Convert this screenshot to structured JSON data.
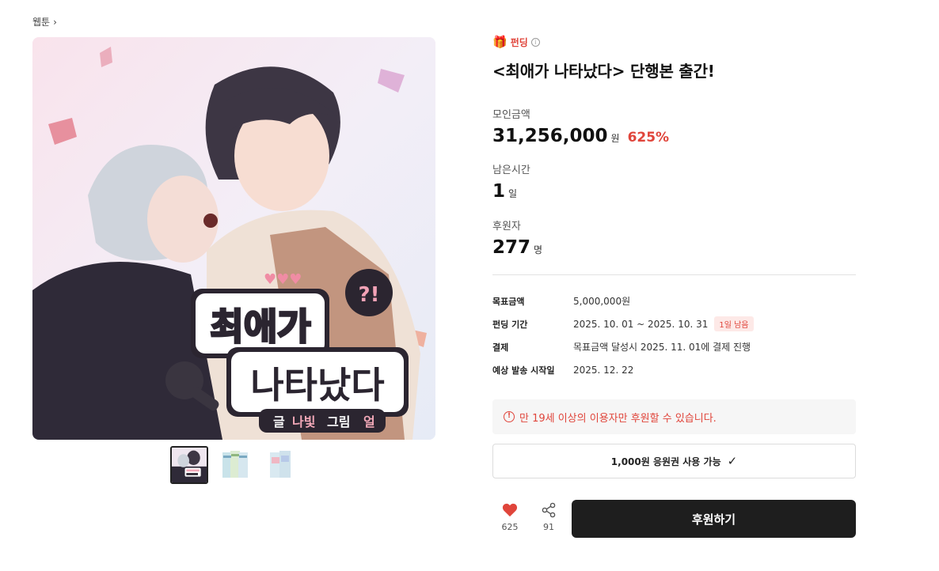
{
  "breadcrumb": {
    "label": "웹툰",
    "chevron": "›"
  },
  "cover": {
    "logo_line1": "최애가",
    "logo_line2": "나타났다",
    "credit_writer_label": "글",
    "credit_writer": "나빛",
    "credit_artist_label": "그림",
    "credit_artist": "얼",
    "badge": "?!"
  },
  "thumbnails": [
    {
      "name": "cover",
      "active": true
    },
    {
      "name": "book-set-1",
      "active": false
    },
    {
      "name": "book-set-2",
      "active": false
    }
  ],
  "tag": {
    "icon": "gift-icon",
    "label": "펀딩",
    "info": "i"
  },
  "title": "<최애가 나타났다> 단행본 출간!",
  "stats": {
    "raised_label": "모인금액",
    "raised_value": "31,256,000",
    "raised_unit": "원",
    "raised_percent": "625%",
    "time_label": "남은시간",
    "time_value": "1",
    "time_unit": "일",
    "backers_label": "후원자",
    "backers_value": "277",
    "backers_unit": "명"
  },
  "details": {
    "goal_label": "목표금액",
    "goal_value": "5,000,000원",
    "period_label": "펀딩 기간",
    "period_value": "2025. 10. 01 ~ 2025. 10. 31",
    "period_badge": "1일 남음",
    "payment_label": "결제",
    "payment_value": "목표금액 달성시 2025. 11. 01에 결제 진행",
    "ship_label": "예상 발송 시작일",
    "ship_value": "2025. 12. 22"
  },
  "notice": {
    "icon": "!",
    "text": "만 19세 이상의 이용자만 후원할 수 있습니다."
  },
  "coupon": {
    "label": "1,000원 응원권 사용 가능",
    "check": "✓"
  },
  "actions": {
    "like_count": "625",
    "share_count": "91",
    "support_label": "후원하기"
  },
  "colors": {
    "accent": "#e0453b",
    "button_bg": "#1e1e1e",
    "notice_bg": "#f6f6f6"
  }
}
